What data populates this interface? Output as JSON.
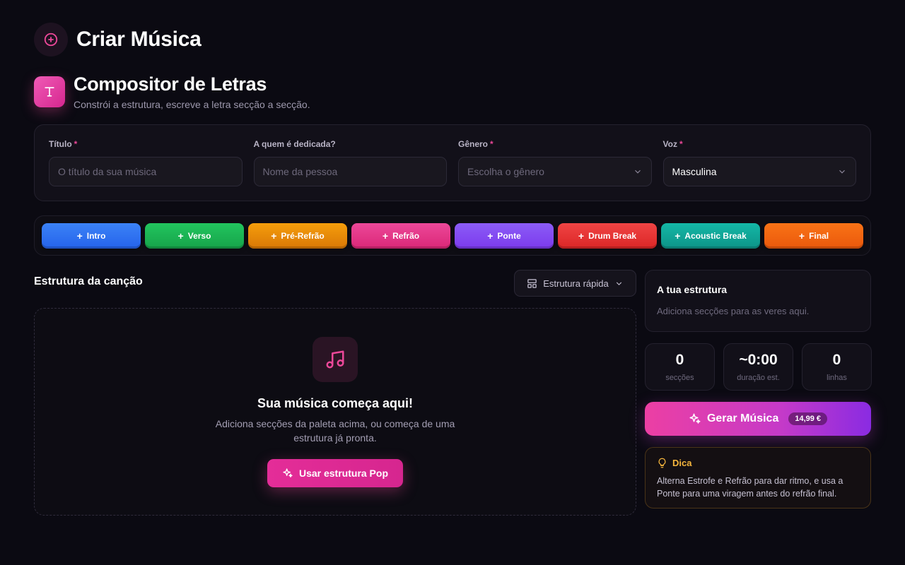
{
  "header": {
    "title": "Criar Música",
    "icon": "plus-circle-icon"
  },
  "composer": {
    "title": "Compositor de Letras",
    "subtitle": "Constrói a estrutura, escreve a letra secção a secção.",
    "icon": "text-t-icon"
  },
  "form": {
    "fields": [
      {
        "label": "Título",
        "required": "*",
        "placeholder": "O título da sua música",
        "value": ""
      },
      {
        "label": "A quem é dedicada?",
        "required": "",
        "placeholder": "Nome da pessoa",
        "value": ""
      },
      {
        "label": "Gênero",
        "required": "*",
        "placeholder": "Escolha o gênero",
        "value": ""
      },
      {
        "label": "Voz",
        "required": "*",
        "placeholder": "",
        "value": "Masculina"
      }
    ]
  },
  "palette": {
    "buttons": [
      {
        "label": "Intro",
        "color_from": "#3b82f6",
        "color_to": "#2563eb"
      },
      {
        "label": "Verso",
        "color_from": "#22c55e",
        "color_to": "#16a34a"
      },
      {
        "label": "Pré-Refrão",
        "color_from": "#f59e0b",
        "color_to": "#d97706"
      },
      {
        "label": "Refrão",
        "color_from": "#ec4899",
        "color_to": "#db2777"
      },
      {
        "label": "Ponte",
        "color_from": "#8b5cf6",
        "color_to": "#7c3aed"
      },
      {
        "label": "Drum Break",
        "color_from": "#ef4444",
        "color_to": "#dc2626"
      },
      {
        "label": "Acoustic Break",
        "color_from": "#14b8a6",
        "color_to": "#0d9488"
      },
      {
        "label": "Final",
        "color_from": "#f97316",
        "color_to": "#ea580c"
      }
    ]
  },
  "structure": {
    "title": "Estrutura da canção",
    "quick_label": "Estrutura rápida",
    "empty_title": "Sua música começa aqui!",
    "empty_desc": "Adiciona secções da paleta acima, ou começa de uma estrutura já pronta.",
    "pop_button": "Usar estrutura Pop"
  },
  "sidebar": {
    "your_structure_title": "A tua estrutura",
    "your_structure_desc": "Adiciona secções para as veres aqui.",
    "stats": [
      {
        "value": "0",
        "label": "secções"
      },
      {
        "value": "~0:00",
        "label": "duração est."
      },
      {
        "value": "0",
        "label": "linhas"
      }
    ],
    "generate_label": "Gerar Música",
    "price": "14,99 €",
    "tip_title": "Dica",
    "tip_text": "Alterna Estrofe e Refrão para dar ritmo, e usa a Ponte para uma viragem antes do refrão final."
  },
  "colors": {
    "accent": "#ec4899",
    "background": "#0b0a12",
    "tip": "#f5b53d"
  }
}
